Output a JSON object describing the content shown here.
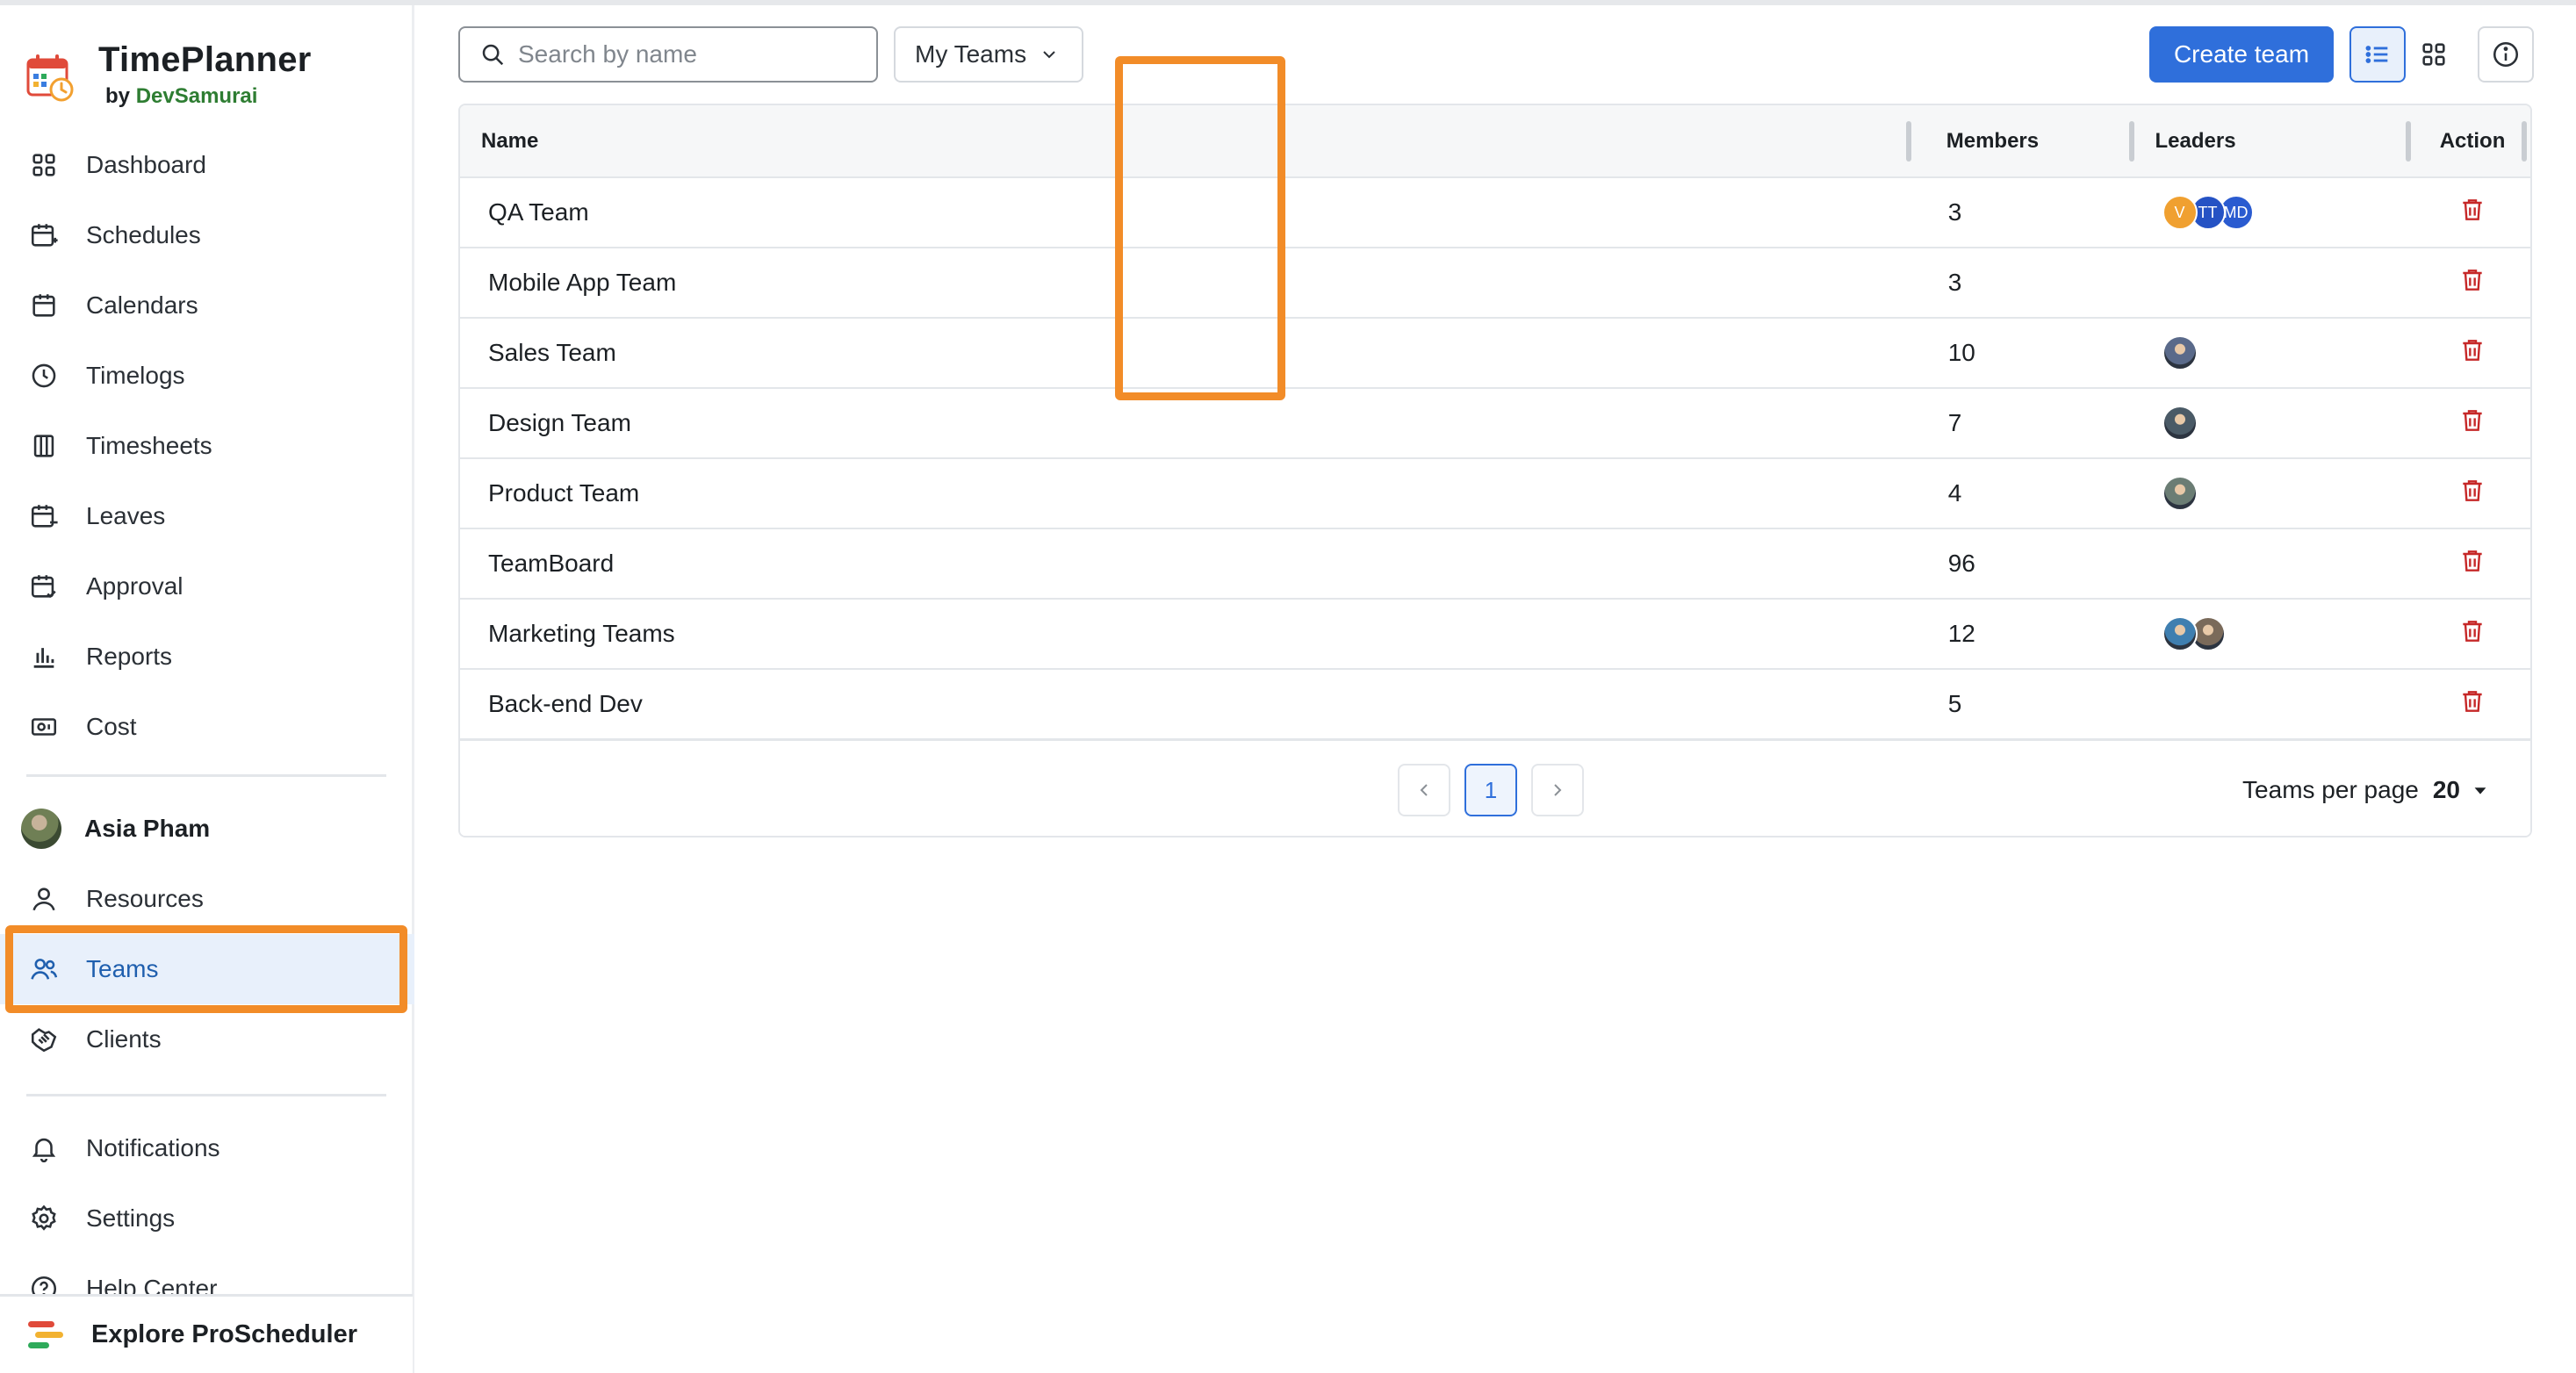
{
  "app": {
    "title": "TimePlanner",
    "by": "by",
    "maker": "DevSamurai"
  },
  "sidebar": {
    "items": [
      {
        "label": "Dashboard",
        "icon": "dashboard-icon"
      },
      {
        "label": "Schedules",
        "icon": "calendar-plus-icon"
      },
      {
        "label": "Calendars",
        "icon": "calendar-icon"
      },
      {
        "label": "Timelogs",
        "icon": "clock-icon"
      },
      {
        "label": "Timesheets",
        "icon": "columns-icon"
      },
      {
        "label": "Leaves",
        "icon": "calendar-minus-icon"
      },
      {
        "label": "Approval",
        "icon": "calendar-check-icon"
      },
      {
        "label": "Reports",
        "icon": "bar-chart-icon"
      },
      {
        "label": "Cost",
        "icon": "cost-icon"
      }
    ],
    "user": {
      "name": "Asia Pham"
    },
    "secondary": [
      {
        "label": "Resources",
        "icon": "person-icon"
      },
      {
        "label": "Teams",
        "icon": "people-icon"
      },
      {
        "label": "Clients",
        "icon": "handshake-icon"
      }
    ],
    "bottom": [
      {
        "label": "Notifications",
        "icon": "bell-icon"
      },
      {
        "label": "Settings",
        "icon": "gear-icon"
      },
      {
        "label": "Help Center",
        "icon": "help-icon"
      }
    ],
    "explore": "Explore ProScheduler"
  },
  "toolbar": {
    "search_placeholder": "Search by name",
    "filter": "My Teams",
    "create": "Create team"
  },
  "table": {
    "headers": {
      "name": "Name",
      "members": "Members",
      "leaders": "Leaders",
      "action": "Action"
    },
    "rows": [
      {
        "name": "QA Team",
        "members": "3",
        "leaders": [
          {
            "type": "initials",
            "text": "V",
            "color": "#f0a030"
          },
          {
            "type": "initials",
            "text": "TT",
            "color": "#2552c4"
          },
          {
            "type": "initials",
            "text": "MD",
            "color": "#2a5bd0"
          }
        ]
      },
      {
        "name": "Mobile App Team",
        "members": "3",
        "leaders": []
      },
      {
        "name": "Sales Team",
        "members": "10",
        "leaders": [
          {
            "type": "photo",
            "color": "#5a6a8a"
          }
        ]
      },
      {
        "name": "Design Team",
        "members": "7",
        "leaders": [
          {
            "type": "photo",
            "color": "#4a5a66"
          }
        ]
      },
      {
        "name": "Product Team",
        "members": "4",
        "leaders": [
          {
            "type": "photo",
            "color": "#6b7d74"
          }
        ]
      },
      {
        "name": "TeamBoard",
        "members": "96",
        "leaders": []
      },
      {
        "name": "Marketing Teams",
        "members": "12",
        "leaders": [
          {
            "type": "photo",
            "color": "#3f7fb0"
          },
          {
            "type": "photo",
            "color": "#7a6a5a"
          }
        ]
      },
      {
        "name": "Back-end Dev",
        "members": "5",
        "leaders": []
      }
    ]
  },
  "pagination": {
    "current": "1",
    "per_page_label": "Teams per page",
    "per_page_value": "20"
  },
  "colors": {
    "accent": "#2f6fdb",
    "highlight": "#f28c28",
    "danger": "#c62828"
  }
}
